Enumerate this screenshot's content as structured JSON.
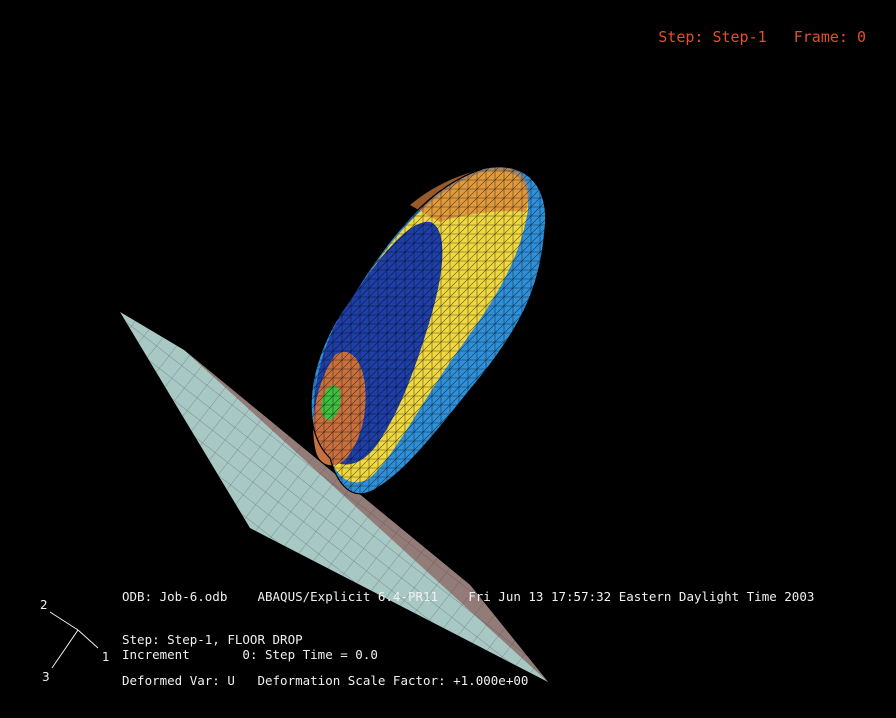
{
  "viewport_title": {
    "step": "Step: Step-1",
    "frame": "Frame: 0"
  },
  "info": {
    "odb": "ODB: Job-6.odb",
    "solver": "ABAQUS/Explicit 6.4-PR11",
    "date": "Fri Jun 13 17:57:32 Eastern Daylight Time 2003",
    "step_line": "Step: Step-1, FLOOR DROP",
    "increment_label": "Increment",
    "increment_value": "0: Step Time = 0.0",
    "deformed_var": "Deformed Var: U",
    "scale_factor": "Deformation Scale Factor: +1.000e+00"
  },
  "triad": {
    "axis_1": "1",
    "axis_2": "2",
    "axis_3": "3"
  },
  "colors": {
    "title": "#e0502a",
    "floor": "#a8c8c4",
    "floor_underside": "#8f6f6a",
    "body_dark_blue": "#1f3fa8",
    "body_light_blue": "#2f8fd8",
    "body_yellow": "#f0d840",
    "body_orange": "#d8803a",
    "body_green": "#40c040"
  }
}
